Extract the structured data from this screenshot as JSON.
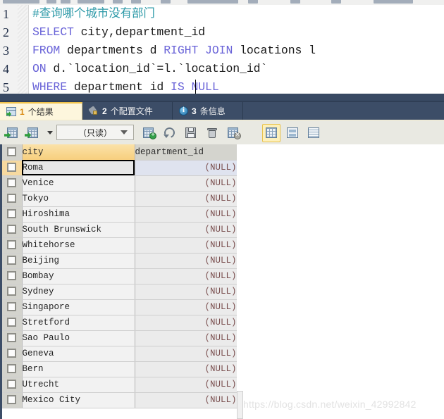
{
  "editor": {
    "lines": [
      {
        "num": "1",
        "segments": [
          {
            "t": "#查询哪个城市没有部门",
            "c": "cmt"
          }
        ]
      },
      {
        "num": "2",
        "segments": [
          {
            "t": "SELECT",
            "c": "kw"
          },
          {
            "t": " city,department_id",
            "c": "plain"
          }
        ]
      },
      {
        "num": "3",
        "segments": [
          {
            "t": "FROM",
            "c": "kw"
          },
          {
            "t": " departments d ",
            "c": "plain"
          },
          {
            "t": "RIGHT JOIN",
            "c": "kw"
          },
          {
            "t": " locations l",
            "c": "plain"
          }
        ]
      },
      {
        "num": "4",
        "segments": [
          {
            "t": "ON",
            "c": "kw"
          },
          {
            "t": " d.`location_id`=l.`location_id`",
            "c": "plain"
          }
        ]
      },
      {
        "num": "5",
        "segments": [
          {
            "t": "WHERE",
            "c": "kw"
          },
          {
            "t": " department id ",
            "c": "plain"
          },
          {
            "t": "IS NULL",
            "c": "kw"
          }
        ]
      }
    ],
    "line1_num": "1",
    "line1_text": "#查询哪个城市没有部门",
    "line2_num": "2",
    "line2_kw": "SELECT",
    "line2_rest": " city,department_id",
    "line3_num": "3",
    "line3_kw": "FROM",
    "line3_mid": " departments d ",
    "line3_kw2": "RIGHT JOIN",
    "line3_rest": " locations l",
    "line4_num": "4",
    "line4_kw": "ON",
    "line4_rest": " d.`location_id`=l.`location_id`",
    "line5_num": "5",
    "line5_kw": "WHERE",
    "line5_mid": " department id ",
    "line5_kw2": "IS NULL"
  },
  "tabs": [
    {
      "num": "1",
      "label": "个结果",
      "icon": "result-grid-icon",
      "active": true
    },
    {
      "num": "2",
      "label": "个配置文件",
      "icon": "profile-wrench-icon",
      "active": false
    },
    {
      "num": "3",
      "label": "条信息",
      "icon": "info-circle-icon",
      "active": false
    }
  ],
  "tab1_num": "1",
  "tab1_label": "个结果",
  "tab2_num": "2",
  "tab2_label": "个配置文件",
  "tab3_num": "3",
  "tab3_label": "条信息",
  "toolbar": {
    "readonly_value": "（只读）",
    "buttons": [
      "apply-changes-icon",
      "import-wizard-icon",
      "dropdown-arrow-icon",
      "add-record-icon",
      "duplicate-record-icon",
      "save-record-icon",
      "delete-record-icon",
      "cancel-record-icon",
      "grid-view-icon",
      "form-view-icon",
      "text-view-icon"
    ]
  },
  "grid": {
    "columns": [
      "city",
      "department_id"
    ],
    "active_column": "city",
    "selected_row_index": 0,
    "null_label": "(NULL)",
    "rows": [
      {
        "city": "Roma",
        "department_id": "(NULL)"
      },
      {
        "city": "Venice",
        "department_id": "(NULL)"
      },
      {
        "city": "Tokyo",
        "department_id": "(NULL)"
      },
      {
        "city": "Hiroshima",
        "department_id": "(NULL)"
      },
      {
        "city": "South Brunswick",
        "department_id": "(NULL)"
      },
      {
        "city": "Whitehorse",
        "department_id": "(NULL)"
      },
      {
        "city": "Beijing",
        "department_id": "(NULL)"
      },
      {
        "city": "Bombay",
        "department_id": "(NULL)"
      },
      {
        "city": "Sydney",
        "department_id": "(NULL)"
      },
      {
        "city": "Singapore",
        "department_id": "(NULL)"
      },
      {
        "city": "Stretford",
        "department_id": "(NULL)"
      },
      {
        "city": "Sao Paulo",
        "department_id": "(NULL)"
      },
      {
        "city": "Geneva",
        "department_id": "(NULL)"
      },
      {
        "city": "Bern",
        "department_id": "(NULL)"
      },
      {
        "city": "Utrecht",
        "department_id": "(NULL)"
      },
      {
        "city": "Mexico City",
        "department_id": "(NULL)"
      }
    ]
  },
  "watermark": "https://blog.csdn.net/weixin_42992842",
  "colors": {
    "keyword": "#6a64d8",
    "comment": "#2e9aa8",
    "navy_band": "#384963",
    "tab_bar": "#3c4d67",
    "active_tab_bg": "#fdf6dd",
    "active_tab_accent": "#f0c24b",
    "col_header_active": "#f7cf7e",
    "null_text": "#7a4f4f",
    "toolbar_bg": "#e9e9e2"
  }
}
